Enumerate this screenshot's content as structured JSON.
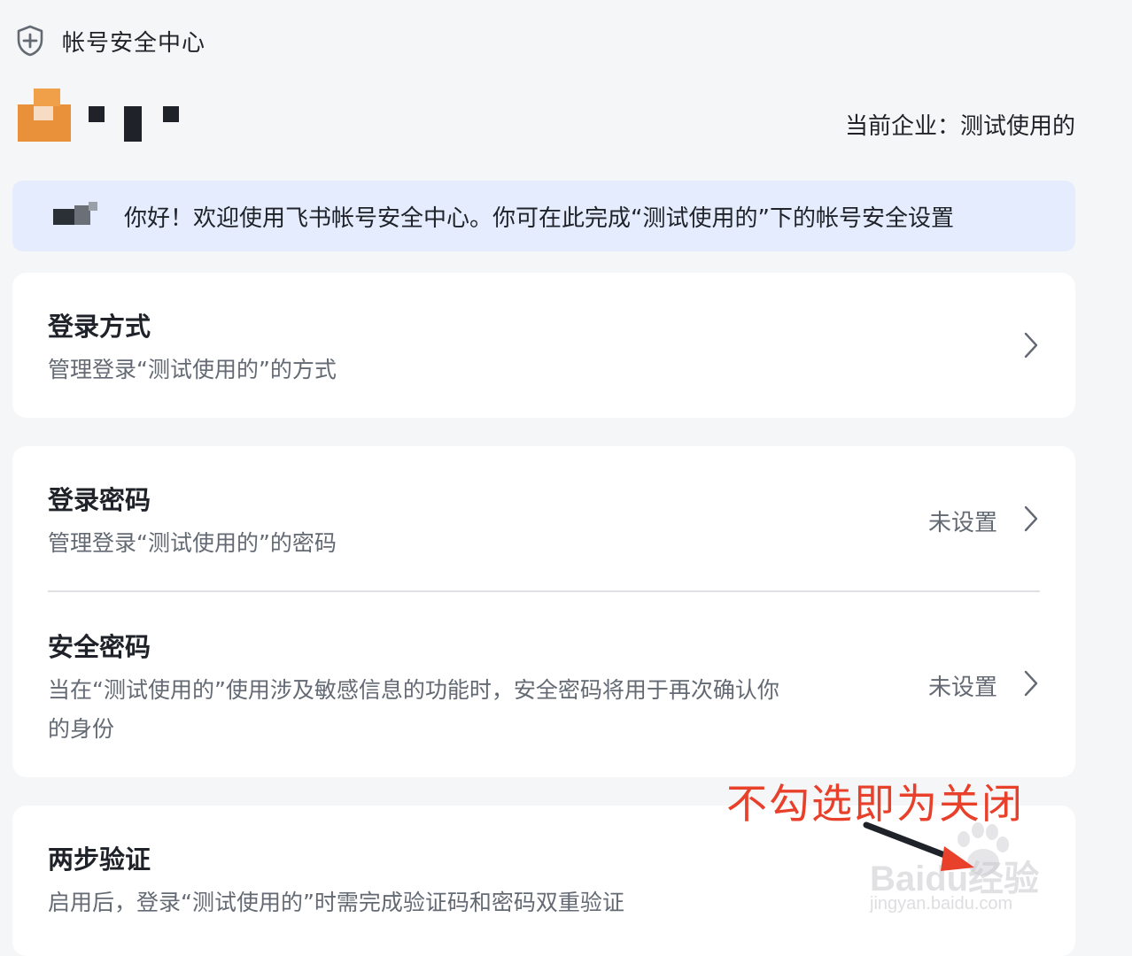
{
  "header": {
    "icon": "shield-plus-icon",
    "title": "帐号安全中心"
  },
  "user": {
    "company_label": "当前企业：测试使用的"
  },
  "welcome": {
    "text": "你好！欢迎使用飞书帐号安全中心。你可在此完成“测试使用的”下的帐号安全设置"
  },
  "login_method": {
    "title": "登录方式",
    "desc": "管理登录“测试使用的”的方式",
    "icon": "chevron-right-icon"
  },
  "login_password": {
    "title": "登录密码",
    "desc": "管理登录“测试使用的”的密码",
    "status": "未设置",
    "icon": "chevron-right-icon"
  },
  "security_password": {
    "title": "安全密码",
    "desc_line1": "当在“测试使用的”使用涉及敏感信息的功能时，安全密码将用于再次确认你",
    "desc_line2": "的身份",
    "status": "未设置",
    "icon": "chevron-right-icon"
  },
  "two_step": {
    "title": "两步验证",
    "desc": "启用后，登录“测试使用的”时需完成验证码和密码双重验证"
  },
  "annotation": {
    "text": "不勾选即为关闭",
    "color": "#e8402a"
  },
  "watermark": {
    "brand": "Baidu经验",
    "url": "jingyan.baidu.com"
  },
  "colors": {
    "background": "#f5f6f7",
    "card": "#ffffff",
    "welcome_bg": "#e4ecfd",
    "text_primary": "#1f2329",
    "text_secondary": "#646a73"
  }
}
